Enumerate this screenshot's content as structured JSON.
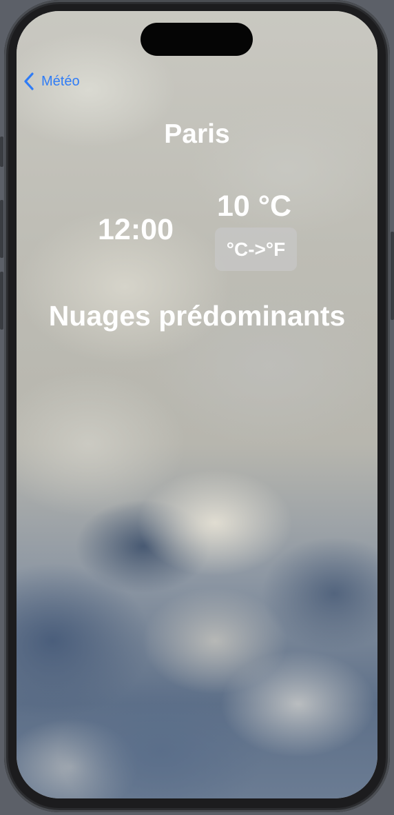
{
  "nav": {
    "back_label": "Météo",
    "back_icon": "chevron-left-icon",
    "accent_color": "#2f7cf6"
  },
  "weather": {
    "city": "Paris",
    "time": "12:00",
    "temperature": "10 °C",
    "unit_toggle_label": "°C->°F",
    "condition": "Nuages prédominants"
  }
}
